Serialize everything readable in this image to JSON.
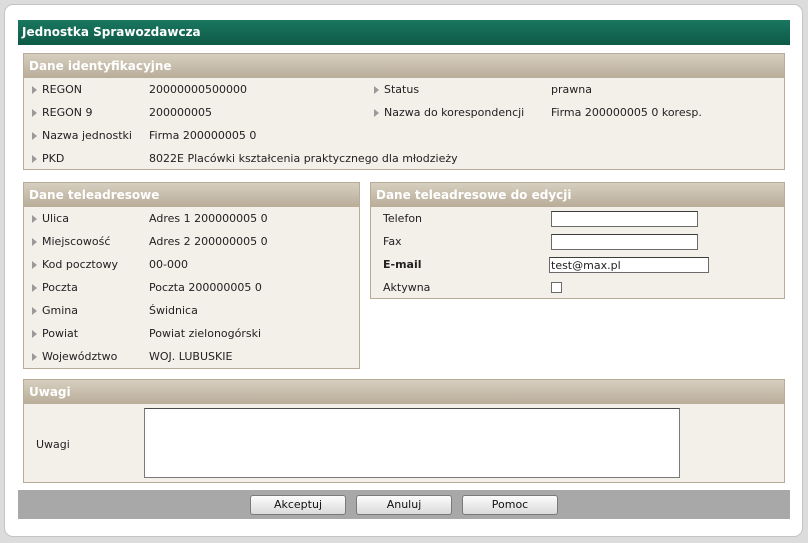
{
  "window": {
    "title": "Jednostka Sprawozdawcza"
  },
  "ident": {
    "header": "Dane identyfikacyjne",
    "regon_label": "REGON",
    "regon_value": "20000000500000",
    "regon9_label": "REGON 9",
    "regon9_value": "200000005",
    "nazwa_label": "Nazwa jednostki",
    "nazwa_value": "Firma 200000005 0",
    "pkd_label": "PKD",
    "pkd_value": "8022E Placówki kształcenia praktycznego dla młodzieży",
    "status_label": "Status",
    "status_value": "prawna",
    "koresp_label": "Nazwa do korespondencji",
    "koresp_value": "Firma 200000005 0 koresp."
  },
  "tele": {
    "header": "Dane teleadresowe",
    "ulica_label": "Ulica",
    "ulica_value": "Adres 1 200000005 0",
    "miejsc_label": "Miejscowość",
    "miejsc_value": "Adres 2 200000005 0",
    "kod_label": "Kod pocztowy",
    "kod_value": "00-000",
    "poczta_label": "Poczta",
    "poczta_value": "Poczta 200000005 0",
    "gmina_label": "Gmina",
    "gmina_value": "Świdnica",
    "powiat_label": "Powiat",
    "powiat_value": "Powiat zielonogórski",
    "woj_label": "Województwo",
    "woj_value": "WOJ. LUBUSKIE"
  },
  "edit": {
    "header": "Dane teleadresowe do edycji",
    "telefon_label": "Telefon",
    "telefon_value": "",
    "fax_label": "Fax",
    "fax_value": "",
    "email_label": "E-mail",
    "email_value": "test@max.pl",
    "aktywna_label": "Aktywna",
    "aktywna_checked": false
  },
  "uwagi": {
    "header": "Uwagi",
    "label": "Uwagi",
    "value": ""
  },
  "buttons": {
    "accept": "Akceptuj",
    "cancel": "Anuluj",
    "help": "Pomoc"
  }
}
